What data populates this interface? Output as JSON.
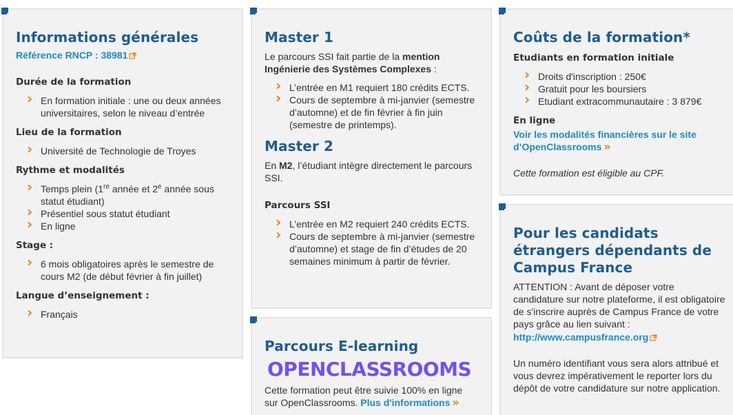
{
  "general": {
    "title": "Informations générales",
    "rncp_link": "Référence RNCP : 38981",
    "duree_heading": "Durée de la formation",
    "duree_items": [
      "En formation initiale : une ou deux années universitaires, selon le niveau d’entrée"
    ],
    "lieu_heading": "Lieu de la formation",
    "lieu_items": [
      "Université de Technologie de Troyes"
    ],
    "rythme_heading": "Rythme et modalités",
    "rythme_item1": {
      "a": "Temps plein (1",
      "sup1": "re",
      "b": " année et 2",
      "sup2": "e",
      "c": " année sous statut étudiant)"
    },
    "rythme_items": [
      "Présentiel sous statut étudiant",
      "En ligne"
    ],
    "stage_heading": "Stage :",
    "stage_items": [
      "6 mois obligatoires après le semestre de cours M2 (de début février à fin juillet)"
    ],
    "langue_heading": "Langue d’enseignement :",
    "langue_items": [
      "Français"
    ]
  },
  "master1": {
    "title": "Master 1",
    "intro_a": "Le parcours SSI fait partie de la ",
    "intro_b": "mention Ingénierie des Systèmes Complexes",
    "intro_c": " :",
    "items": [
      "L’entrée en M1 requiert 180 crédits ECTS.",
      "Cours de septembre à mi-janvier (semestre d’automne) et de fin février à fin juin (semestre de printemps)."
    ]
  },
  "master2": {
    "title": "Master 2",
    "intro_a": "En ",
    "intro_b": "M2",
    "intro_c": ", l’étudiant intègre directement le parcours SSI.",
    "subheading": "Parcours SSI",
    "items": [
      "L’entrée en M2 requiert 240 crédits ECTS.",
      "Cours de septembre à mi-janvier (semestre d’automne) et stage de fin d’études de 20 semaines minimum à partir de février."
    ]
  },
  "elearning": {
    "title": "Parcours E-learning",
    "logo_text": "OPENCLASSROOMS",
    "text": "Cette formation peut être suivie 100% en ligne sur OpenClassrooms. ",
    "link": "Plus d'informations"
  },
  "couts": {
    "title": "Coûts de la formation*",
    "initial_heading": "Etudiants en formation initiale",
    "items": [
      "Droits d'inscription : 250€",
      "Gratuit pour les boursiers",
      "Etudiant extracommunautaire : 3 879€"
    ],
    "online_heading": "En ligne",
    "online_link": "Voir les modalités financières sur le site d’OpenClassrooms",
    "cpf_note": "Cette formation est éligible au CPF."
  },
  "campus": {
    "title": "Pour les candidats étrangers dépendants de Campus France",
    "attention": "ATTENTION : Avant de déposer votre candidature sur notre plateforme, il est obligatoire de s'inscrire auprès de Campus France de votre pays grâce au lien suivant :",
    "link": "http://www.campusfrance.org",
    "note": "Un numéro identifiant vous sera alors attribué et vous devrez impérativement le reporter lors du dépôt de votre candidature sur notre application."
  },
  "colors": {
    "heading": "#1f5d8f",
    "link": "#1e8bc3",
    "chevron": "#e8801e",
    "logo": "#7451eb",
    "card_bg": "#f2f2f2"
  },
  "icons": [
    "external-link-icon",
    "chevron-right-icon"
  ]
}
